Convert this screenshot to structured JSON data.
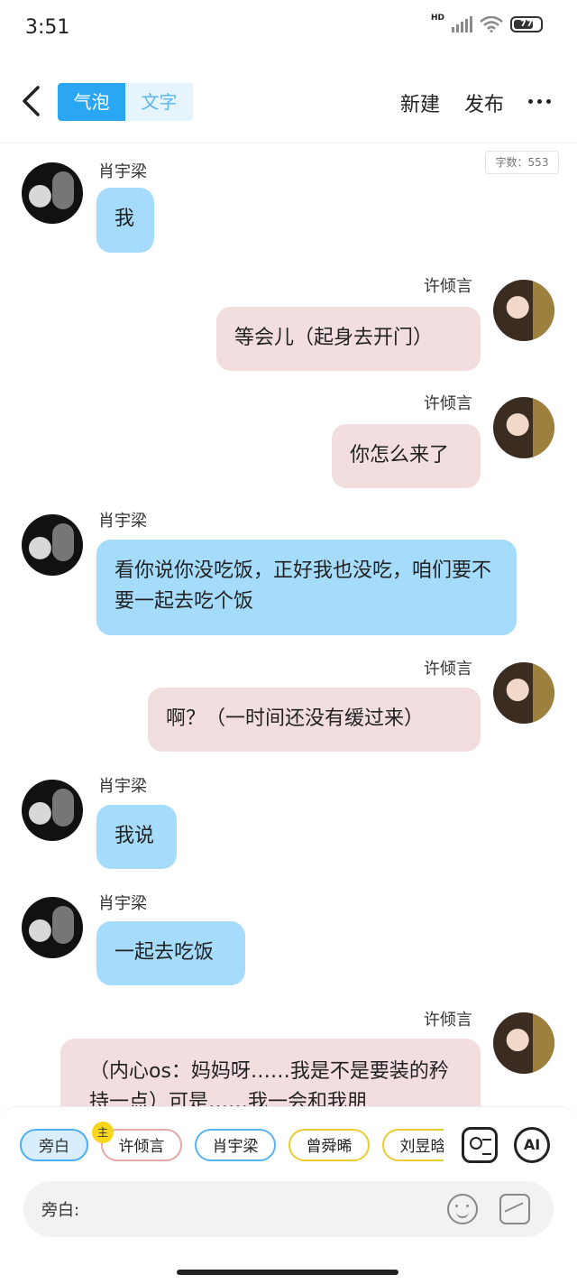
{
  "status_bar": {
    "time": "3:51",
    "network": "HD",
    "battery": "77",
    "battery_level_percent": 77
  },
  "nav": {
    "tabs": [
      {
        "label": "气泡",
        "active": true
      },
      {
        "label": "文字",
        "active": false
      }
    ],
    "new_label": "新建",
    "publish_label": "发布"
  },
  "word_count": "字数：553",
  "messages": [
    {
      "sender": "肖宇梁",
      "side": "left",
      "text": "我"
    },
    {
      "sender": "许倾言",
      "side": "right",
      "text": "等会儿（起身去开门）"
    },
    {
      "sender": "许倾言",
      "side": "right",
      "text": "你怎么来了"
    },
    {
      "sender": "肖宇梁",
      "side": "left",
      "text": "看你说你没吃饭，正好我也没吃，咱们要不要一起去吃个饭"
    },
    {
      "sender": "许倾言",
      "side": "right",
      "text": "啊？（一时间还没有缓过来）"
    },
    {
      "sender": "肖宇梁",
      "side": "left",
      "text": "我说"
    },
    {
      "sender": "肖宇梁",
      "side": "left",
      "text": "一起去吃饭"
    },
    {
      "sender": "许倾言",
      "side": "right",
      "text": "（内心os：妈妈呀……我是不是要装的矜持一点）可是……我一会和我朋"
    }
  ],
  "roles": [
    {
      "label": "旁白",
      "selected": true
    },
    {
      "label": "许倾言",
      "badge": "主"
    },
    {
      "label": "肖宇梁"
    },
    {
      "label": "曾舜晞"
    },
    {
      "label": "刘昱晗"
    }
  ],
  "ai_label": "AI",
  "input": {
    "placeholder": "旁白:"
  },
  "colors": {
    "accent": "#2aa6f2",
    "left_bubble": "#a6dcfb",
    "right_bubble": "#f2dede"
  }
}
